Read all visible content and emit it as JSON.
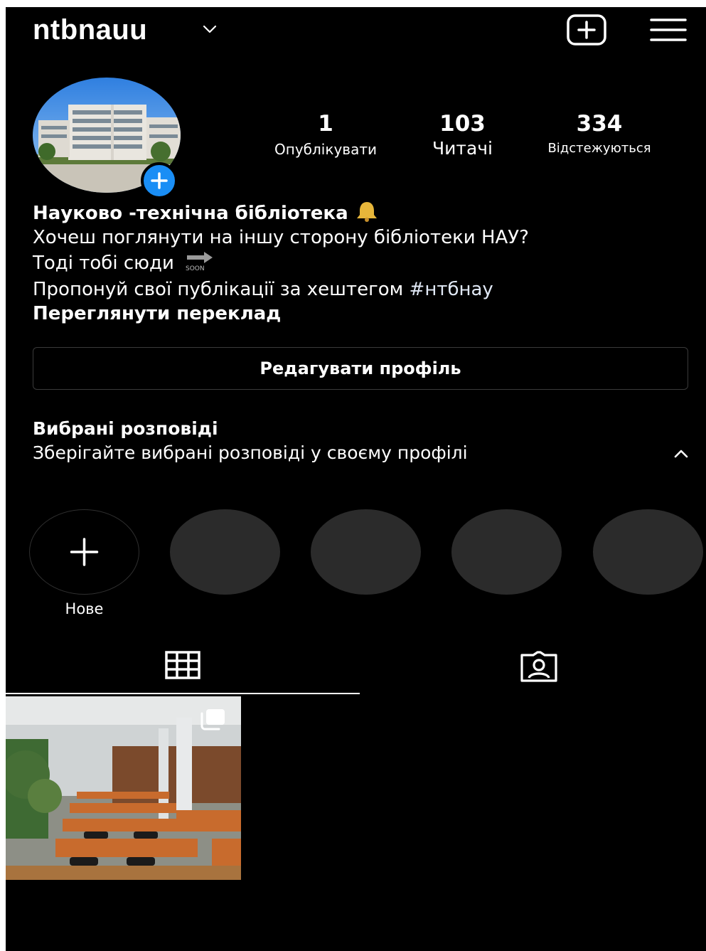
{
  "header": {
    "username": "ntbnauu"
  },
  "stats": {
    "posts": {
      "count": "1",
      "label": "Опублікувати"
    },
    "followers": {
      "count": "103",
      "label": "Читачі"
    },
    "following": {
      "count": "334",
      "label": "Відстежуються"
    }
  },
  "bio": {
    "name": "Науково -технічна бібліотека",
    "line1": "Хочеш поглянути на іншу сторону бібліотеки НАУ?",
    "line2": "Тоді тобі сюди",
    "soon_label": "SOON",
    "line3_prefix": "Пропонуй свої публікації за хештегом ",
    "hashtag": "#нтбнау",
    "translate": "Переглянути переклад"
  },
  "edit_profile_label": "Редагувати профіль",
  "highlights": {
    "title": "Вибрані розповіді",
    "subtitle": "Зберігайте вибрані розповіді у своєму профілі",
    "new_label": "Нове"
  },
  "icons": {
    "header": [
      "chevron-down-icon",
      "new-post-icon",
      "menu-icon"
    ],
    "avatar_badge": "plus-icon",
    "tabs": [
      "grid-icon",
      "tagged-icon"
    ],
    "post_badge": "multiple-photos-icon"
  },
  "colors": {
    "background": "#000000",
    "text": "#ffffff",
    "accent": "#1a8ef5",
    "story_placeholder": "#2b2b2b"
  }
}
